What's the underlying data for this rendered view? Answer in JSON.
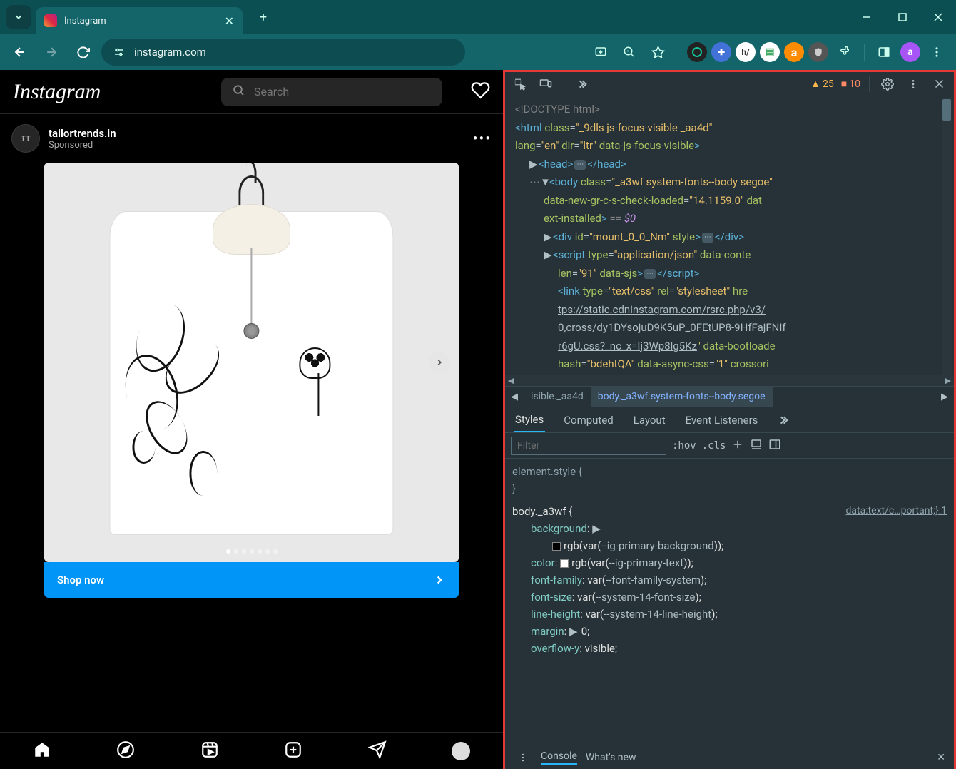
{
  "browser": {
    "tab_title": "Instagram",
    "url": "instagram.com"
  },
  "instagram": {
    "logo_text": "Instagram",
    "search_placeholder": "Search",
    "post": {
      "username": "tailortrends.in",
      "sponsored_label": "Sponsored",
      "cta_label": "Shop now",
      "avatar_initials": "TT"
    }
  },
  "devtools": {
    "warnings_count": "25",
    "errors_count": "10",
    "breadcrumb": {
      "prev": "isible._aa4d",
      "current": "body._a3wf.system-fonts--body.segoe"
    },
    "tabs": {
      "styles": "Styles",
      "computed": "Computed",
      "layout": "Layout",
      "event_listeners": "Event Listeners"
    },
    "filter_placeholder": "Filter",
    "hov_label": ":hov",
    "cls_label": ".cls",
    "dom": {
      "doctype": "<!DOCTYPE html>",
      "html_open_1": "<html",
      "html_open_class_attr": "class",
      "html_open_class_val": "\"_9dls js-focus-visible _aa4d\"",
      "html_lang_attr": "lang",
      "html_lang_val": "\"en\"",
      "html_dir_attr": "dir",
      "html_dir_val": "\"ltr\"",
      "html_jsfocus_attr": "data-js-focus-visible",
      "html_close_gt": ">",
      "head_open": "<head>",
      "head_close": "</head>",
      "body_open": "<body",
      "body_class_attr": "class",
      "body_class_val": "\"_a3wf system-fonts--body segoe\"",
      "body_gr_attr": "data-new-gr-c-s-check-loaded",
      "body_gr_val": "\"14.1159.0\"",
      "body_ext_label": "ext-installed",
      "body_eq": "== ",
      "body_eq_val": "$0",
      "body_dat_label": "dat",
      "div_open": "<div",
      "div_id_attr": "id",
      "div_id_val": "\"mount_0_0_Nm\"",
      "div_style_attr": "style",
      "div_close": "</div>",
      "script_open": "<script",
      "script_type_attr": "type",
      "script_type_val": "\"application/json\"",
      "script_datacontent": "data-conte",
      "script_len_attr": "len",
      "script_len_val": "\"91\"",
      "script_sjs_attr": "data-sjs",
      "script_close_tag": "</script>",
      "link_open": "<link",
      "link_type_attr": "type",
      "link_type_val": "\"text/css\"",
      "link_rel_attr": "rel",
      "link_rel_val": "\"stylesheet\"",
      "link_href_attr": "hre",
      "link_url_1": "tps://static.cdninstagram.com/rsrc.php/v3/",
      "link_url_2": "0,cross/dy1DYsojuD9K5uP_0FEtUP8-9HfFajFNIf",
      "link_url_3": "r6gU.css?_nc_x=Ij3Wp8lg5Kz",
      "link_bootloader": "data-bootloade",
      "link_hash_attr": "hash",
      "link_hash_val": "\"bdehtQA\"",
      "link_async_attr": "data-async-css",
      "link_async_val": "\"1\"",
      "link_crossori": "crossori"
    },
    "styles_panel": {
      "element_style_open": "element.style {",
      "element_style_close": "}",
      "body_rule_sel": "body._a3wf {",
      "source": "data:text/c…portant;}:1",
      "background_prop": "background",
      "background_val": "rgb(var(",
      "background_var": "--ig-primary-background",
      "background_val_end": "));",
      "color_prop": "color",
      "color_val": "rgb(var(",
      "color_var": "--ig-primary-text",
      "color_val_end": "));",
      "ff_prop": "font-family",
      "ff_val": "var(",
      "ff_var": "--font-family-system",
      "ff_end": ");",
      "fs_prop": "font-size",
      "fs_val": "var(",
      "fs_var": "--system-14-font-size",
      "fs_end": ");",
      "lh_prop": "line-height",
      "lh_val": "var(",
      "lh_var": "--system-14-line-height",
      "lh_end": ");",
      "margin_prop": "margin",
      "margin_val": "0;",
      "oy_prop": "overflow-y",
      "oy_val": "visible;"
    },
    "drawer": {
      "console": "Console",
      "whatsnew": "What's new"
    }
  }
}
